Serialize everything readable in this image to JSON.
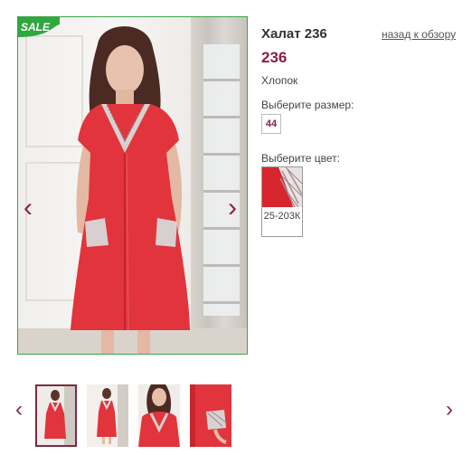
{
  "product": {
    "title": "Халат 236",
    "price": "236",
    "material": "Хлопок",
    "back_link": "назад к обзору"
  },
  "size": {
    "label": "Выберите размер:",
    "options": [
      "44"
    ]
  },
  "color": {
    "label": "Выберите цвет:",
    "options": [
      "25-203К"
    ]
  },
  "gallery": {
    "badge": "SALE",
    "main_prev_icon": "chevron-left-icon",
    "main_next_icon": "chevron-right-icon",
    "prev_arrow": "‹",
    "next_arrow": "›",
    "thumbnail_count": 4
  },
  "colors": {
    "accent": "#8b1e3f",
    "badge_green": "#2ea83f",
    "dress_red": "#e2343c",
    "image_border": "#3aa64a"
  }
}
